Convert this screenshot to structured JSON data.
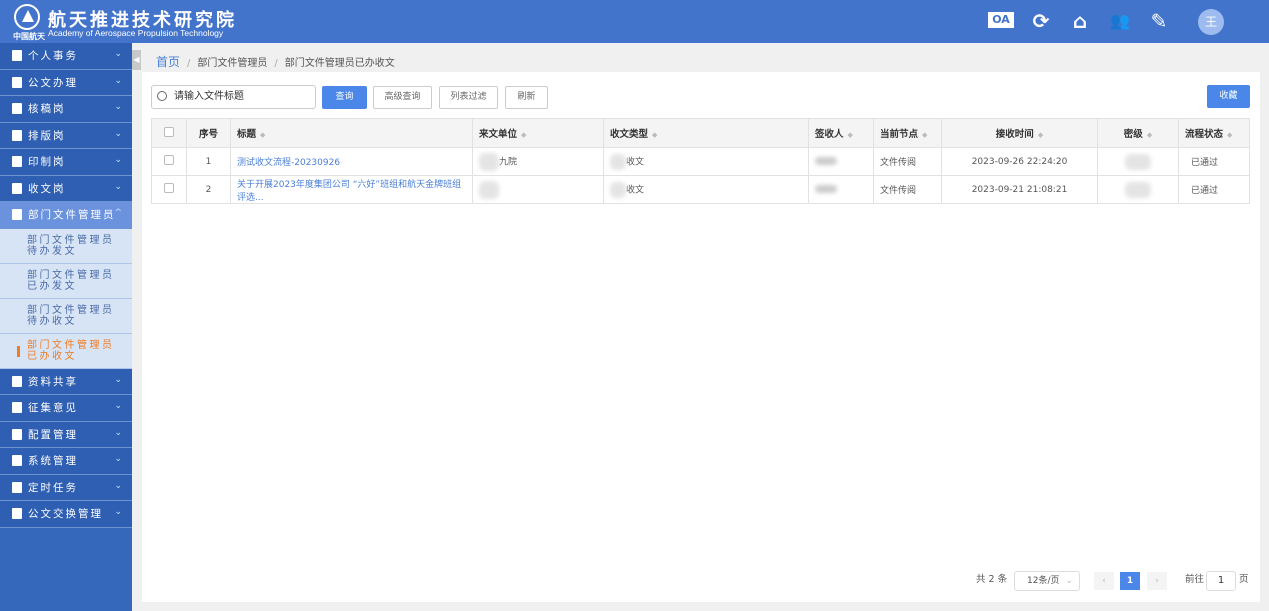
{
  "header": {
    "brand_cn": "中国航天",
    "title": "航天推进技术研究院",
    "subtitle": "Academy of Aerospace Propulsion Technology",
    "icons": [
      "oa-icon",
      "refresh-icon",
      "home-icon",
      "users-icon",
      "edit-icon"
    ],
    "oa_label": "OA",
    "avatar": "王"
  },
  "sidebar": {
    "items": [
      {
        "label": "个人事务",
        "icon": "document-icon"
      },
      {
        "label": "公文办理",
        "icon": "document-icon"
      },
      {
        "label": "核稿岗",
        "icon": "document-icon"
      },
      {
        "label": "排版岗",
        "icon": "document-icon"
      },
      {
        "label": "印制岗",
        "icon": "document-icon"
      },
      {
        "label": "收文岗",
        "icon": "document-icon"
      },
      {
        "label": "部门文件管理员",
        "icon": "document-icon",
        "open": true
      }
    ],
    "sub": [
      {
        "line1": "部门文件管理员",
        "line2": "待办发文"
      },
      {
        "line1": "部门文件管理员",
        "line2": "已办发文"
      },
      {
        "line1": "部门文件管理员",
        "line2": "待办收文"
      },
      {
        "line1": "部门文件管理员",
        "line2": "已办收文",
        "active": true
      }
    ],
    "items2": [
      {
        "label": "资料共享",
        "icon": "document-icon"
      },
      {
        "label": "征集意见",
        "icon": "document-icon"
      },
      {
        "label": "配置管理",
        "icon": "calendar-icon"
      },
      {
        "label": "系统管理",
        "icon": "gear-icon"
      },
      {
        "label": "定时任务",
        "icon": "document-icon"
      },
      {
        "label": "公文交换管理",
        "icon": "document-icon"
      }
    ]
  },
  "breadcrumb": [
    "首页",
    "部门文件管理员",
    "部门文件管理员已办收文"
  ],
  "toolbar": {
    "search_placeholder": "请输入文件标题",
    "query": "查询",
    "advanced": "高级查询",
    "filter": "列表过滤",
    "refresh": "刷新",
    "favorite": "收藏"
  },
  "table": {
    "columns": [
      "序号",
      "标题",
      "来文单位",
      "收文类型",
      "签收人",
      "当前节点",
      "接收时间",
      "密级",
      "流程状态"
    ],
    "rows": [
      {
        "no": "1",
        "title": "测试收文流程-20230926",
        "unit": "九院",
        "type": "收文",
        "node": "文件传阅",
        "time": "2023-09-26 22:24:20",
        "status": "已通过"
      },
      {
        "no": "2",
        "title": "关于开展2023年度集团公司 “六好”班组和航天金牌班组评选...",
        "unit": "",
        "type": "收文",
        "node": "文件传阅",
        "time": "2023-09-21 21:08:21",
        "status": "已通过"
      }
    ]
  },
  "pagination": {
    "total": "共 2 条",
    "page_size": "12条/页",
    "current": "1",
    "goto": "前往",
    "goto_value": "1",
    "page_suffix": "页"
  },
  "colors": {
    "header": "#4374cb",
    "sidebar": "#2f5fb2",
    "accent": "#4a87e8",
    "active": "#f07b22"
  }
}
